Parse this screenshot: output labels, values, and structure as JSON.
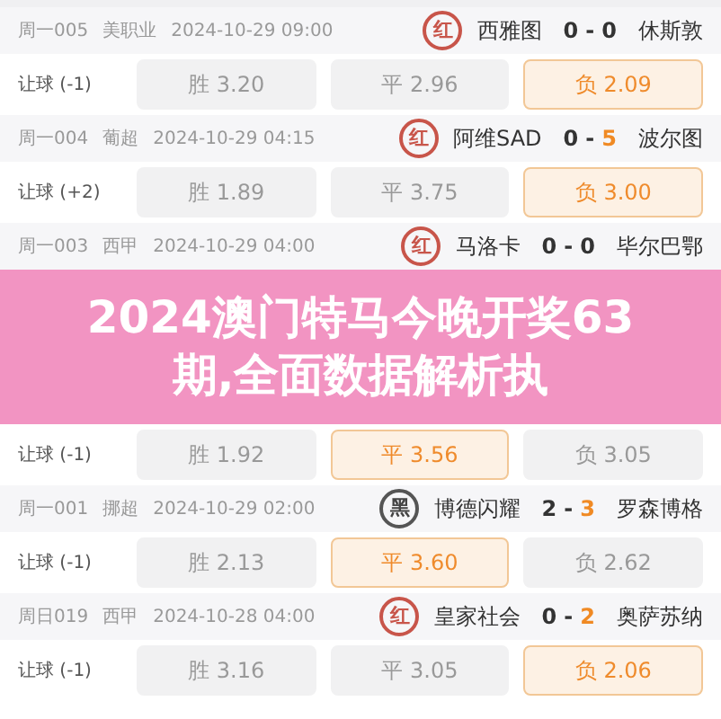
{
  "matches_top": [
    {
      "header": {
        "code": "周一005",
        "league": "美职业",
        "time": "2024-10-29 09:00",
        "stamp": {
          "text": "红",
          "kind": "red"
        },
        "home": "西雅图",
        "score": {
          "home": "0",
          "sep": "-",
          "away": "0",
          "away_highlight": false
        },
        "away": "休斯敦"
      },
      "odds": {
        "label": "让球 (-1)",
        "options": [
          {
            "text": "胜 3.20",
            "selected": false
          },
          {
            "text": "平 2.96",
            "selected": false
          },
          {
            "text": "负 2.09",
            "selected": true
          }
        ]
      }
    },
    {
      "header": {
        "code": "周一004",
        "league": "葡超",
        "time": "2024-10-29 04:15",
        "stamp": {
          "text": "红",
          "kind": "red"
        },
        "home": "阿维SAD",
        "score": {
          "home": "0",
          "sep": "-",
          "away": "5",
          "away_highlight": true
        },
        "away": "波尔图"
      },
      "odds": {
        "label": "让球 (+2)",
        "options": [
          {
            "text": "胜 1.89",
            "selected": false
          },
          {
            "text": "平 3.75",
            "selected": false
          },
          {
            "text": "负 3.00",
            "selected": true
          }
        ]
      }
    },
    {
      "header": {
        "code": "周一003",
        "league": "西甲",
        "time": "2024-10-29 04:00",
        "stamp": {
          "text": "红",
          "kind": "red"
        },
        "home": "马洛卡",
        "score": {
          "home": "0",
          "sep": "-",
          "away": "0",
          "away_highlight": false
        },
        "away": "毕尔巴鄂"
      }
    }
  ],
  "banner": {
    "title": "2024澳门特马今晚开奖63期,全面数据解析执"
  },
  "matches_bottom": [
    {
      "odds": {
        "label": "让球 (-1)",
        "options": [
          {
            "text": "胜 1.92",
            "selected": false
          },
          {
            "text": "平 3.56",
            "selected": true
          },
          {
            "text": "负 3.05",
            "selected": false
          }
        ]
      }
    },
    {
      "header": {
        "code": "周一001",
        "league": "挪超",
        "time": "2024-10-29 02:00",
        "stamp": {
          "text": "黑",
          "kind": "black"
        },
        "home": "博德闪耀",
        "score": {
          "home": "2",
          "sep": "-",
          "away": "3",
          "away_highlight": true
        },
        "away": "罗森博格"
      },
      "odds": {
        "label": "让球 (-1)",
        "options": [
          {
            "text": "胜 2.13",
            "selected": false
          },
          {
            "text": "平 3.60",
            "selected": true
          },
          {
            "text": "负 2.62",
            "selected": false
          }
        ]
      }
    },
    {
      "header": {
        "code": "周日019",
        "league": "西甲",
        "time": "2024-10-28 04:00",
        "stamp": {
          "text": "红",
          "kind": "red"
        },
        "home": "皇家社会",
        "score": {
          "home": "0",
          "sep": "-",
          "away": "2",
          "away_highlight": true
        },
        "away": "奥萨苏纳"
      },
      "odds": {
        "label": "让球 (-1)",
        "options": [
          {
            "text": "胜 3.16",
            "selected": false
          },
          {
            "text": "平 3.05",
            "selected": false
          },
          {
            "text": "负 2.06",
            "selected": true
          }
        ]
      }
    }
  ]
}
